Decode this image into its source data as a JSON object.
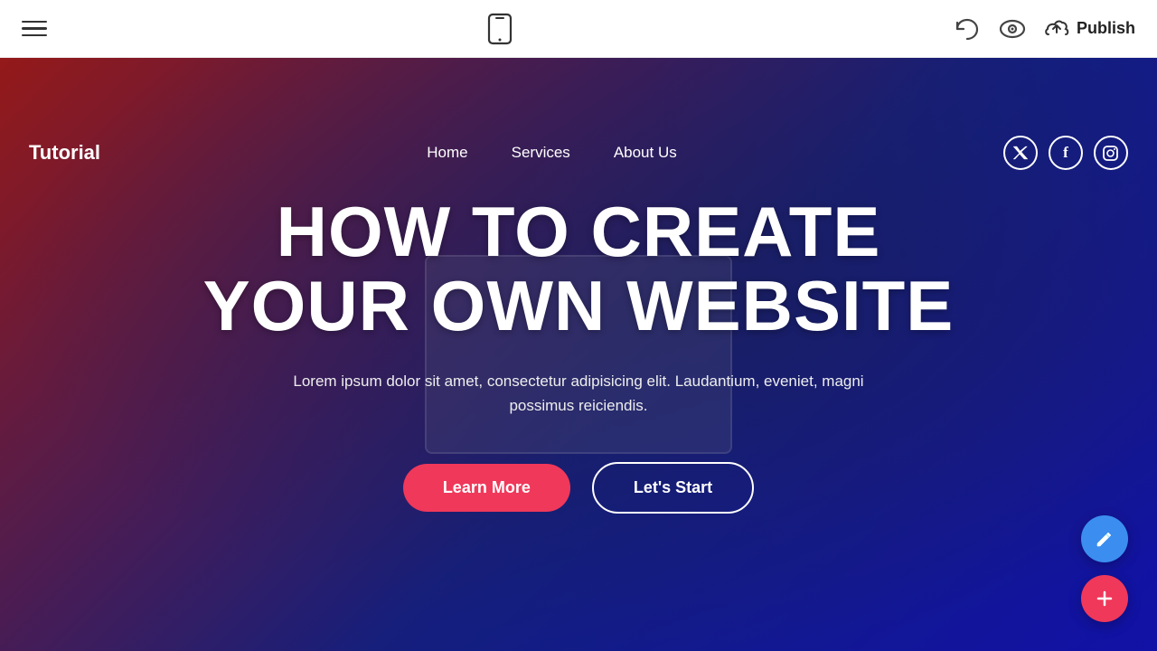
{
  "toolbar": {
    "hamburger_label": "menu",
    "phone_icon": "📱",
    "undo_label": "undo",
    "eye_label": "preview",
    "publish_label": "Publish",
    "upload_label": "upload"
  },
  "site_nav": {
    "logo": "Tutorial",
    "links": [
      {
        "label": "Home",
        "id": "home"
      },
      {
        "label": "Services",
        "id": "services"
      },
      {
        "label": "About Us",
        "id": "about"
      }
    ],
    "socials": [
      {
        "label": "Twitter",
        "icon": "𝕏",
        "id": "twitter"
      },
      {
        "label": "Facebook",
        "icon": "f",
        "id": "facebook"
      },
      {
        "label": "Instagram",
        "icon": "◻",
        "id": "instagram"
      }
    ]
  },
  "hero": {
    "title_line1": "HOW TO CREATE",
    "title_line2": "YOUR OWN WEBSITE",
    "subtitle": "Lorem ipsum dolor sit amet, consectetur adipisicing elit. Laudantium, eveniet, magni possimus reiciendis.",
    "btn_learn": "Learn More",
    "btn_start": "Let's Start"
  },
  "fabs": {
    "pencil_label": "edit",
    "plus_label": "add"
  }
}
